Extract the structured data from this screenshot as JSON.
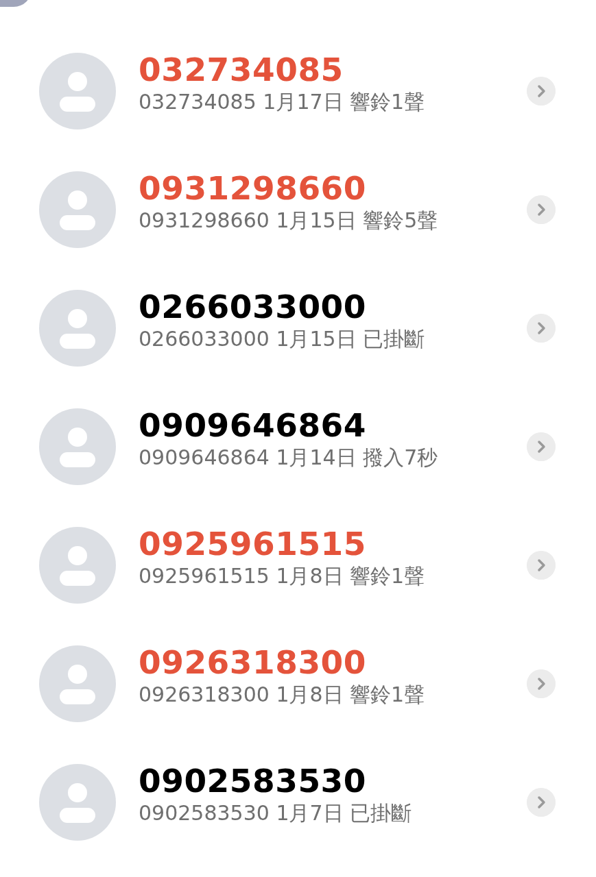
{
  "calls": [
    {
      "name": "032734085",
      "detail": "032734085 1月17日 響鈴1聲",
      "missed": true
    },
    {
      "name": "0931298660",
      "detail": "0931298660 1月15日 響鈴5聲",
      "missed": true
    },
    {
      "name": "0266033000",
      "detail": "0266033000 1月15日 已掛斷",
      "missed": false
    },
    {
      "name": "0909646864",
      "detail": "0909646864 1月14日 撥入7秒",
      "missed": false
    },
    {
      "name": "0925961515",
      "detail": "0925961515 1月8日 響鈴1聲",
      "missed": true
    },
    {
      "name": "0926318300",
      "detail": "0926318300 1月8日 響鈴1聲",
      "missed": true
    },
    {
      "name": "0902583530",
      "detail": "0902583530 1月7日 已掛斷",
      "missed": false
    }
  ]
}
